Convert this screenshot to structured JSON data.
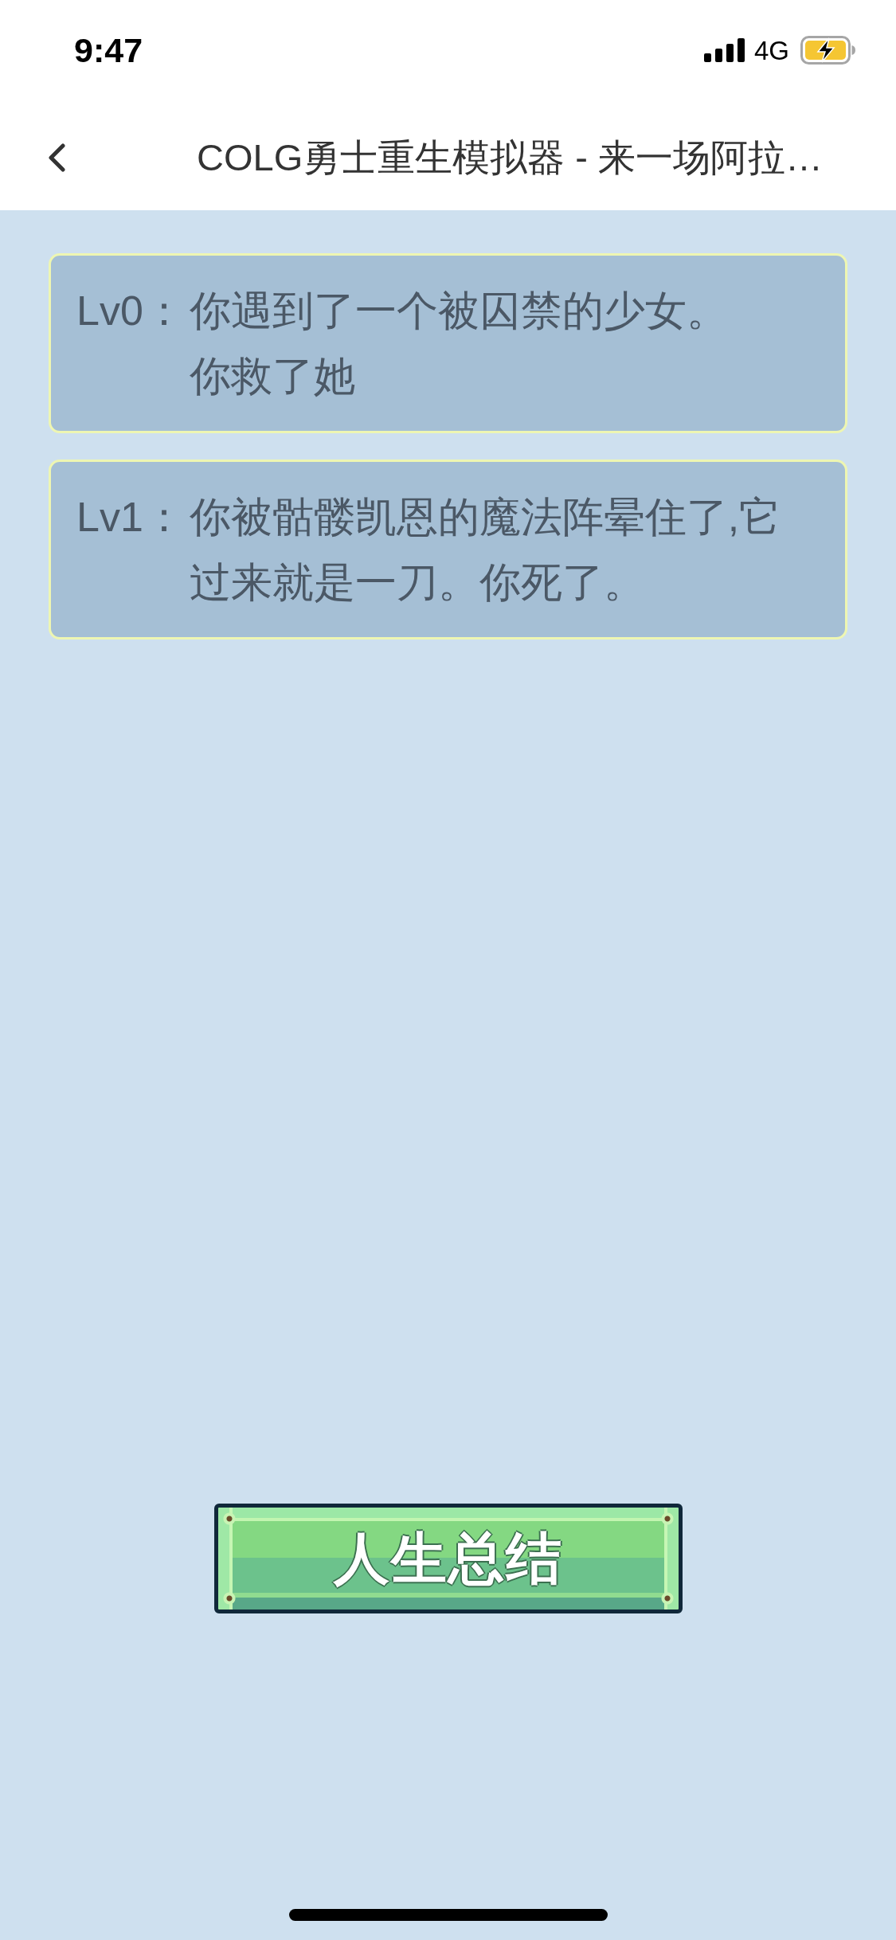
{
  "status_bar": {
    "time": "9:47",
    "network": "4G"
  },
  "nav_bar": {
    "title": "COLG勇士重生模拟器 - 来一场阿拉…"
  },
  "events": [
    {
      "stage": "Lv0：",
      "lines": [
        "你遇到了一个被囚禁的少女。",
        "你救了她"
      ]
    },
    {
      "stage": "Lv1：",
      "lines": [
        "你被骷髅凯恩的魔法阵晕住了,它过来就是一刀。你死了。"
      ]
    }
  ],
  "summary_button": {
    "label": "人生总结"
  }
}
